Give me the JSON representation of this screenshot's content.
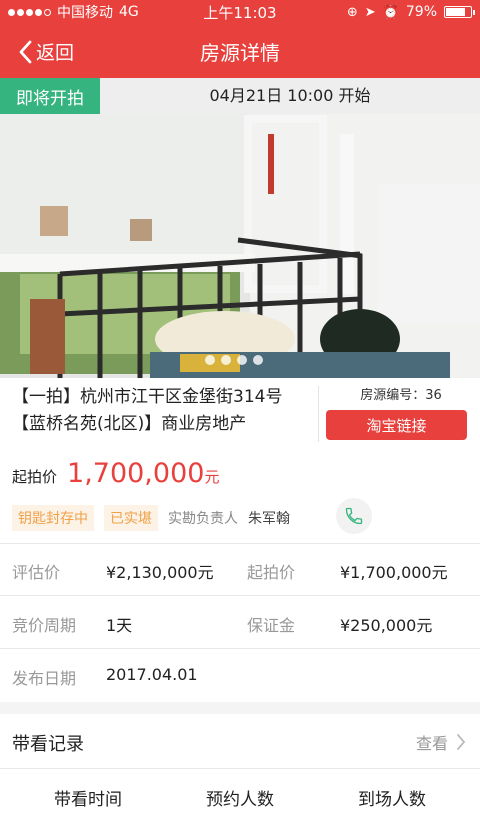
{
  "status_bar": {
    "carrier": "中国移动",
    "network": "4G",
    "time": "上午11:03",
    "battery": "79%",
    "battery_level": 0.79
  },
  "nav": {
    "back_label": "返回",
    "title": "房源详情"
  },
  "banner": {
    "status_tag": "即将开拍",
    "start_time": "04月21日 10:00 开始"
  },
  "property": {
    "title": "【一拍】杭州市江干区金堡街314号【蓝桥名苑(北区)】商业房地产",
    "id_label": "房源编号：36",
    "taobao_button": "淘宝链接"
  },
  "price": {
    "label": "起拍价",
    "value": "1,700,000",
    "unit": "元"
  },
  "tags": {
    "key_sealed": "钥匙封存中",
    "inspected": "已实堪",
    "inspector_label": "实勘负责人",
    "inspector_name": "朱军翰"
  },
  "details": {
    "appraisal_label": "评估价",
    "appraisal_value": "¥2,130,000元",
    "start_price_label": "起拍价",
    "start_price_value": "¥1,700,000元",
    "bid_period_label": "竞价周期",
    "bid_period_value": "1天",
    "deposit_label": "保证金",
    "deposit_value": "¥250,000元",
    "publish_date_label": "发布日期",
    "publish_date_value": "2017.04.01"
  },
  "viewing": {
    "title": "带看记录",
    "view_link": "查看",
    "columns": [
      "带看时间",
      "预约人数",
      "到场人数"
    ]
  },
  "colors": {
    "brand_red": "#e8403d",
    "status_green": "#35b47f",
    "tag_orange": "#f0a14a"
  },
  "icons": {
    "back": "chevron-left-icon",
    "phone": "phone-icon",
    "more": "chevron-right-icon"
  }
}
